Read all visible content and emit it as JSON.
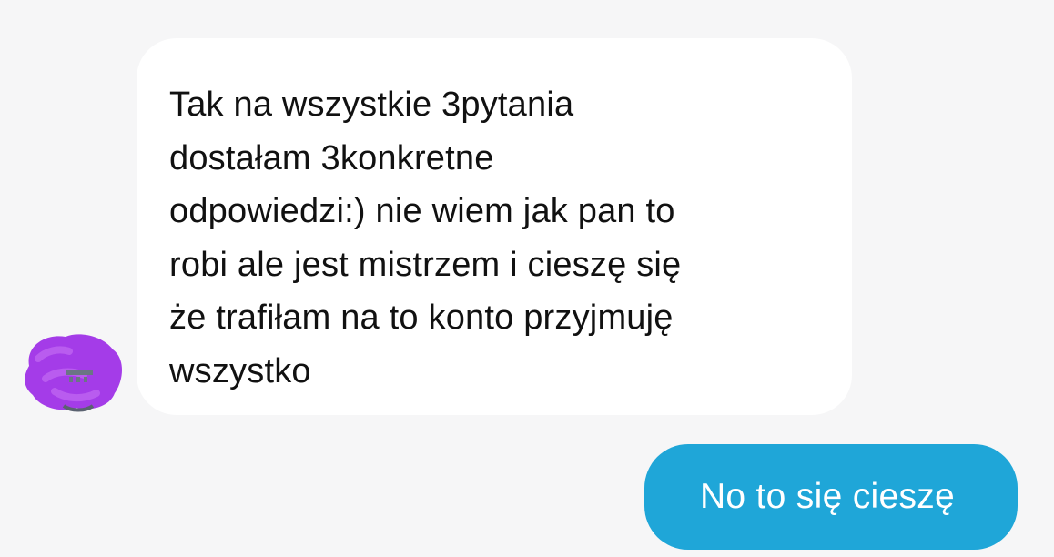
{
  "conversation": {
    "incoming": {
      "sender_avatar_icon": "avatar-redacted-icon",
      "message": "Tak na wszystkie 3pytania\ndostałam 3konkretne\nodpowiedzi:) nie wiem jak pan to\nrobi ale jest mistrzem i cieszę się\nże trafiłam na to konto przyjmuję\nwszystko",
      "bubble_color": "#ffffff",
      "text_color": "#111111"
    },
    "outgoing": {
      "message": "No to się cieszę",
      "bubble_color": "#1fa6d8",
      "text_color": "#ffffff"
    },
    "background_color": "#f6f6f7"
  }
}
